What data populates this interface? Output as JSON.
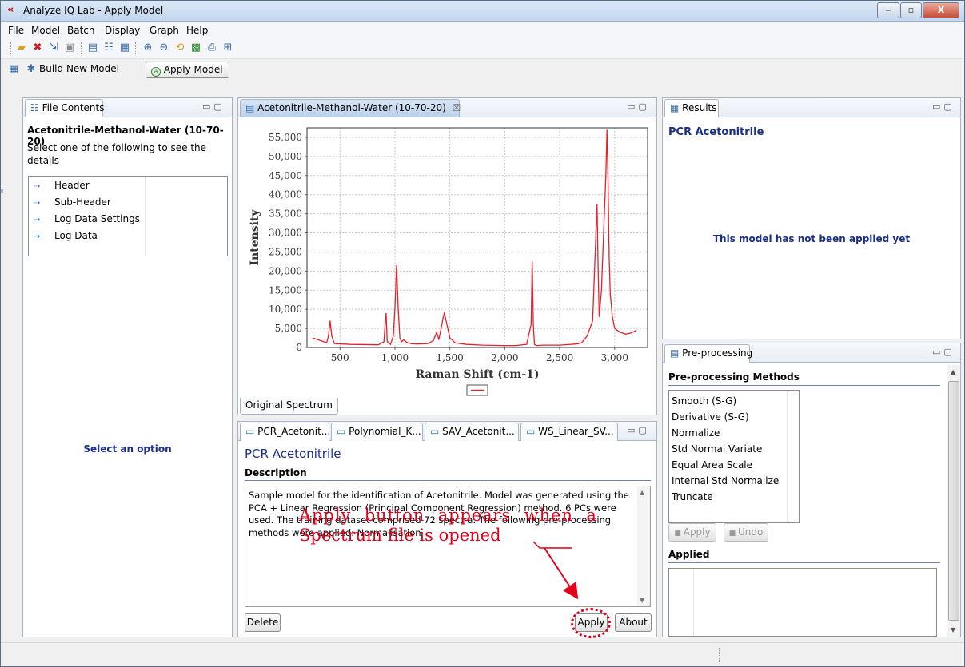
{
  "window": {
    "title": "Analyze IQ Lab - Apply Model",
    "controls": {
      "minimize": "‒",
      "maximize": "▫",
      "close": "X"
    }
  },
  "menu": [
    "File",
    "Model",
    "Batch",
    "Display",
    "Graph",
    "Help"
  ],
  "toolbar_icons": [
    "open-folder-icon",
    "delete-icon",
    "import-icon",
    "save-icon",
    "model-icon",
    "tree-icon",
    "properties-icon",
    "zoom-in-icon",
    "zoom-out-icon",
    "reset-zoom-icon",
    "chart-icon",
    "print-icon",
    "layout-icon"
  ],
  "modebar": {
    "build_label": "Build New Model",
    "apply_label": "Apply Model"
  },
  "file_contents": {
    "tab": "File Contents",
    "heading": "Acetonitrile-Methanol-Water (10-70-20)",
    "instruction": "Select one of the following to see the details",
    "items": [
      {
        "label": "Header"
      },
      {
        "label": "Sub-Header"
      },
      {
        "label": "Log Data Settings"
      },
      {
        "label": "Log Data"
      }
    ],
    "placeholder": "Select an option"
  },
  "spectrum_view": {
    "tab": "Acetonitrile-Methanol-Water (10-70-20)",
    "close_glyph": "☒",
    "bottom_tab": "Original Spectrum"
  },
  "chart_data": {
    "type": "line",
    "title": "",
    "xlabel": "Raman Shift (cm-1)",
    "ylabel": "Intensity",
    "xlim": [
      200,
      3300
    ],
    "ylim": [
      0,
      57500
    ],
    "xticks": [
      500,
      1000,
      1500,
      2000,
      2500,
      3000
    ],
    "xtick_labels": [
      "500",
      "1,000",
      "1,500",
      "2,000",
      "2,500",
      "3,000"
    ],
    "yticks": [
      0,
      5000,
      10000,
      15000,
      20000,
      25000,
      30000,
      35000,
      40000,
      45000,
      50000,
      55000
    ],
    "ytick_labels": [
      "0",
      "5,000",
      "10,000",
      "15,000",
      "20,000",
      "25,000",
      "30,000",
      "35,000",
      "40,000",
      "45,000",
      "50,000",
      "55,000"
    ],
    "grid": true,
    "legend": "bottom",
    "series": [
      {
        "color": "#e8202a",
        "x": [
          250,
          350,
          380,
          395,
          410,
          425,
          450,
          600,
          850,
          900,
          915,
          920,
          930,
          960,
          985,
          1000,
          1015,
          1030,
          1045,
          1060,
          1080,
          1100,
          1120,
          1150,
          1200,
          1300,
          1350,
          1380,
          1400,
          1420,
          1440,
          1450,
          1470,
          1500,
          1550,
          1650,
          1800,
          2000,
          2100,
          2200,
          2240,
          2250,
          2260,
          2270,
          2290,
          2350,
          2500,
          2650,
          2700,
          2750,
          2800,
          2830,
          2840,
          2850,
          2860,
          2880,
          2900,
          2920,
          2930,
          2940,
          2950,
          2960,
          2980,
          3000,
          3050,
          3100,
          3150,
          3200
        ],
        "y": [
          2500,
          1500,
          1300,
          3000,
          7000,
          3000,
          1000,
          800,
          700,
          1500,
          8000,
          9000,
          1500,
          800,
          3000,
          10000,
          21500,
          10000,
          2500,
          1500,
          2000,
          1500,
          1200,
          1000,
          900,
          1000,
          1800,
          4000,
          2000,
          5000,
          8000,
          9000,
          6500,
          2500,
          1200,
          800,
          600,
          500,
          500,
          800,
          6000,
          22500,
          6000,
          800,
          500,
          600,
          600,
          900,
          1200,
          3000,
          7000,
          30000,
          37500,
          20000,
          8000,
          15000,
          30000,
          45000,
          57000,
          44000,
          24000,
          14000,
          8000,
          5000,
          4000,
          3500,
          3800,
          4500
        ]
      }
    ]
  },
  "models": {
    "tabs": [
      "PCR_Acetonit...",
      "Polynomial_K...",
      "SAV_Acetonit...",
      "WS_Linear_SV..."
    ],
    "title": "PCR Acetonitrile",
    "description_heading": "Description",
    "description": "Sample model for the identification of Acetonitrile. Model was generated using the PCA + Linear Regression (Principal Component Regression) method. 6 PCs were used. The training dataset comprised 72 spectra. The following pre-processing methods were applied: Normalisation",
    "buttons": {
      "delete": "Delete",
      "apply": "Apply",
      "about": "About"
    }
  },
  "annotation": {
    "line1": "Apply button appears when a",
    "line2": "Spectrum file is opened",
    "color": "#e1001a"
  },
  "results": {
    "tab": "Results",
    "title": "PCR Acetonitrile",
    "message": "This model has not been applied yet"
  },
  "preprocessing": {
    "tab": "Pre-processing",
    "heading": "Pre-processing Methods",
    "methods": [
      "Smooth (S-G)",
      "Derivative (S-G)",
      "Normalize",
      "Std Normal Variate",
      "Equal Area Scale",
      "Internal Std Normalize",
      "Truncate"
    ],
    "apply": "Apply",
    "undo": "Undo",
    "applied_heading": "Applied"
  },
  "colors": {
    "accent_blue": "#1a2e8a",
    "spectrum": "#e8202a",
    "active_tab": "#b9cfe9"
  }
}
